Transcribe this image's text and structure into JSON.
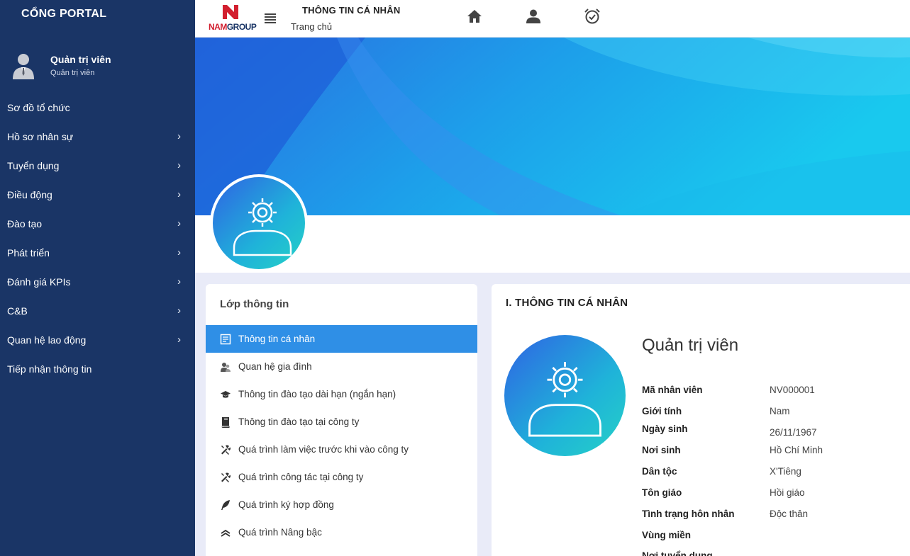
{
  "sidebar": {
    "brand": "CỔNG PORTAL",
    "user_name": "Quản trị viên",
    "user_role": "Quản trị viên",
    "menu": [
      {
        "label": "Sơ đồ tổ chức",
        "chevron": ""
      },
      {
        "label": "Hồ sơ nhân sự",
        "chevron": "›"
      },
      {
        "label": "Tuyển dụng",
        "chevron": "›"
      },
      {
        "label": "Điều động",
        "chevron": "›"
      },
      {
        "label": "Đào tạo",
        "chevron": "›"
      },
      {
        "label": "Phát triển",
        "chevron": "›"
      },
      {
        "label": "Đánh giá KPIs",
        "chevron": "›"
      },
      {
        "label": "C&B",
        "chevron": "›"
      },
      {
        "label": "Quan hệ lao động",
        "chevron": "›"
      },
      {
        "label": "Tiếp nhận thông tin",
        "chevron": ""
      }
    ]
  },
  "header": {
    "logo_nam": "NAM",
    "logo_group": "GROUP",
    "title": "THÔNG TIN CÁ NHÂN",
    "breadcrumb": "Trang chủ",
    "icons": [
      "home-icon",
      "user-icon",
      "alarm-clock-icon"
    ]
  },
  "info_layers": {
    "title": "Lớp thông tin",
    "items": [
      {
        "label": "Thông tin cá nhân",
        "icon": "id-card-icon",
        "active": true
      },
      {
        "label": "Quan hệ gia đình",
        "icon": "family-icon",
        "active": false
      },
      {
        "label": "Thông tin đào tạo dài hạn (ngắn hạn)",
        "icon": "graduation-cap-icon",
        "active": false
      },
      {
        "label": "Thông tin đào tạo tại công ty",
        "icon": "book-icon",
        "active": false
      },
      {
        "label": "Quá trình làm việc trước khi vào công ty",
        "icon": "tools-icon",
        "active": false
      },
      {
        "label": "Quá trình công tác tại công ty",
        "icon": "tools-icon",
        "active": false
      },
      {
        "label": "Quá trình ký hợp đồng",
        "icon": "feather-icon",
        "active": false
      },
      {
        "label": "Quá trình Nâng bậc",
        "icon": "chevrons-up-icon",
        "active": false
      }
    ]
  },
  "personal": {
    "section_title": "I. THÔNG TIN CÁ NHÂN",
    "full_name": "Quản trị viên",
    "fields": [
      {
        "label": "Mã nhân viên",
        "value": "NV000001"
      },
      {
        "label": "Giới tính",
        "value": "Nam"
      },
      {
        "label": "Ngày sinh",
        "value": "26/11/1967"
      },
      {
        "label": "Nơi sinh",
        "value": "Hồ Chí Minh"
      },
      {
        "label": "Dân tộc",
        "value": "X'Tiêng"
      },
      {
        "label": "Tôn giáo",
        "value": "Hồi giáo"
      },
      {
        "label": "Tình trạng hôn nhân",
        "value": "Độc thân"
      },
      {
        "label": "Vùng miền",
        "value": ""
      },
      {
        "label": "Nơi tuyển dụng",
        "value": ""
      }
    ]
  },
  "colors": {
    "sidebar_bg": "#1a3566",
    "active_tab": "#2f8fe6",
    "brand_red": "#d21f2f"
  }
}
